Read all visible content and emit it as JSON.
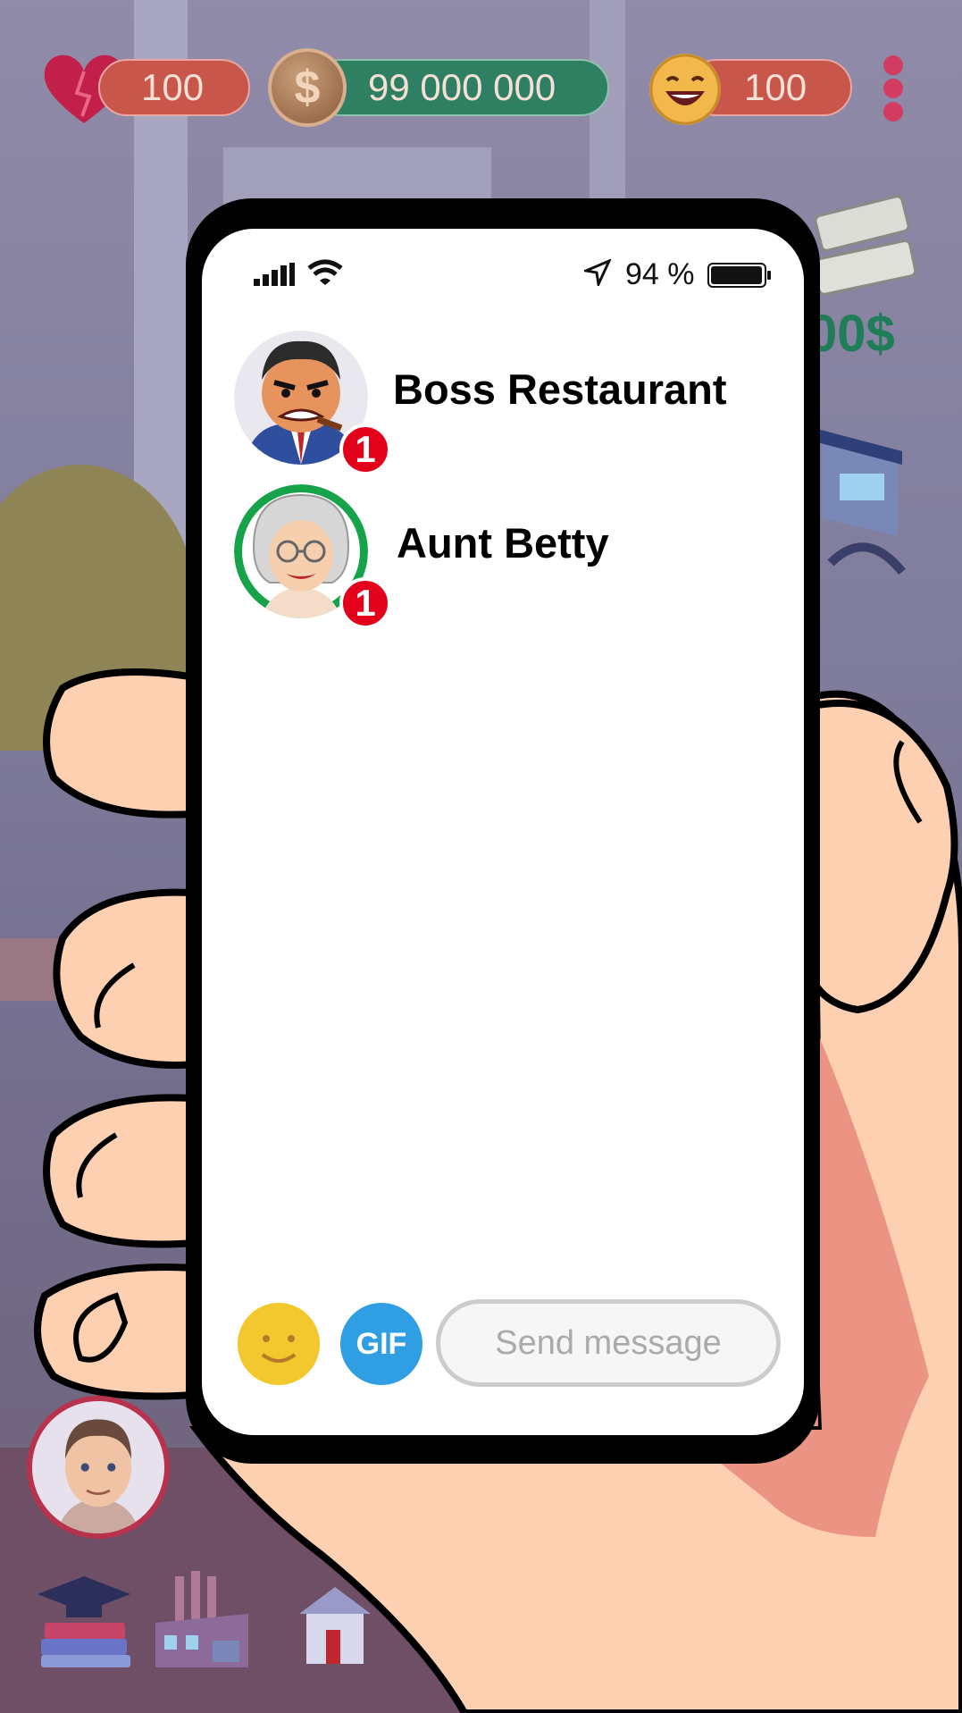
{
  "hud": {
    "lives": "100",
    "money": "99 000 000",
    "laughs": "100",
    "coin_symbol": "$"
  },
  "background": {
    "cash_text": "00$"
  },
  "phone": {
    "status": {
      "battery_text": "94 %"
    },
    "chats": [
      {
        "name": "Boss Restaurant",
        "unread": "1",
        "avatar": "boss-avatar"
      },
      {
        "name": "Aunt Betty",
        "unread": "1",
        "avatar": "grandma-avatar"
      }
    ],
    "composer": {
      "gif_label": "GIF",
      "placeholder": "Send message"
    }
  },
  "colors": {
    "accent_red": "#e3001b",
    "money_green": "#2f7f63",
    "hud_red": "#c8564a",
    "gif_blue": "#2f9ee3",
    "emoji_yellow": "#f3c82e"
  },
  "icons": [
    "heart-icon",
    "coin-icon",
    "laugh-emoji-icon",
    "menu-dots-icon",
    "signal-icon",
    "wifi-icon",
    "location-icon",
    "battery-icon",
    "smiley-icon",
    "graduation-icon",
    "factory-icon",
    "house-icon"
  ]
}
